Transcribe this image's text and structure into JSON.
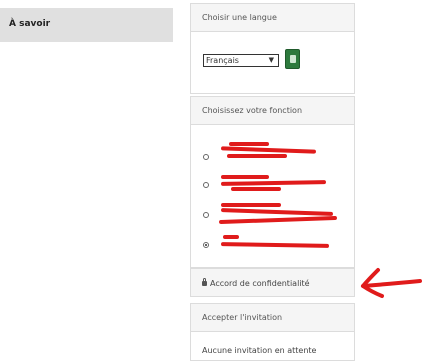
{
  "nav": {
    "tab_label": "À savoir"
  },
  "language_panel": {
    "title": "Choisir une langue",
    "selected": "Français",
    "go_icon": "book-icon"
  },
  "role_panel": {
    "title": "Choisissez votre fonction",
    "options_count": 4,
    "selected_index": 3
  },
  "nda_panel": {
    "label": "Accord de confidentialité",
    "icon": "lock-icon"
  },
  "accept_panel": {
    "title": "Accepter l'invitation",
    "empty_text": "Aucune invitation en attente"
  },
  "annotation": {
    "arrow_color": "#e01b1b"
  },
  "colors": {
    "accent_green": "#2d7a3d",
    "panel_header": "#f5f5f5",
    "border": "#dcdcdc"
  }
}
